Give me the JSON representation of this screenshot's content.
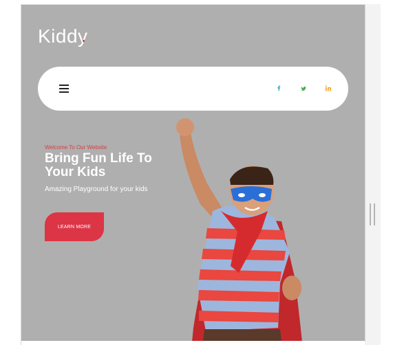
{
  "brand": {
    "logo_text": "Kiddy"
  },
  "navbar": {
    "menu_icon": "hamburger-menu-icon",
    "social": [
      {
        "name": "facebook-icon",
        "color": "#2aa7b8"
      },
      {
        "name": "twitter-icon",
        "color": "#4caf50"
      },
      {
        "name": "linkedin-icon",
        "color": "#f0a020"
      }
    ]
  },
  "hero": {
    "kicker": "Welcome To Our Website",
    "headline": "Bring Fun Life To Your Kids",
    "subtitle": "Amazing Playground for your kids",
    "cta_label": "LEARN MORE",
    "cta_color": "#dc3545",
    "image": "superhero-kid-photo"
  },
  "colors": {
    "hero_background": "#afafaf",
    "accent": "#e0303c"
  }
}
